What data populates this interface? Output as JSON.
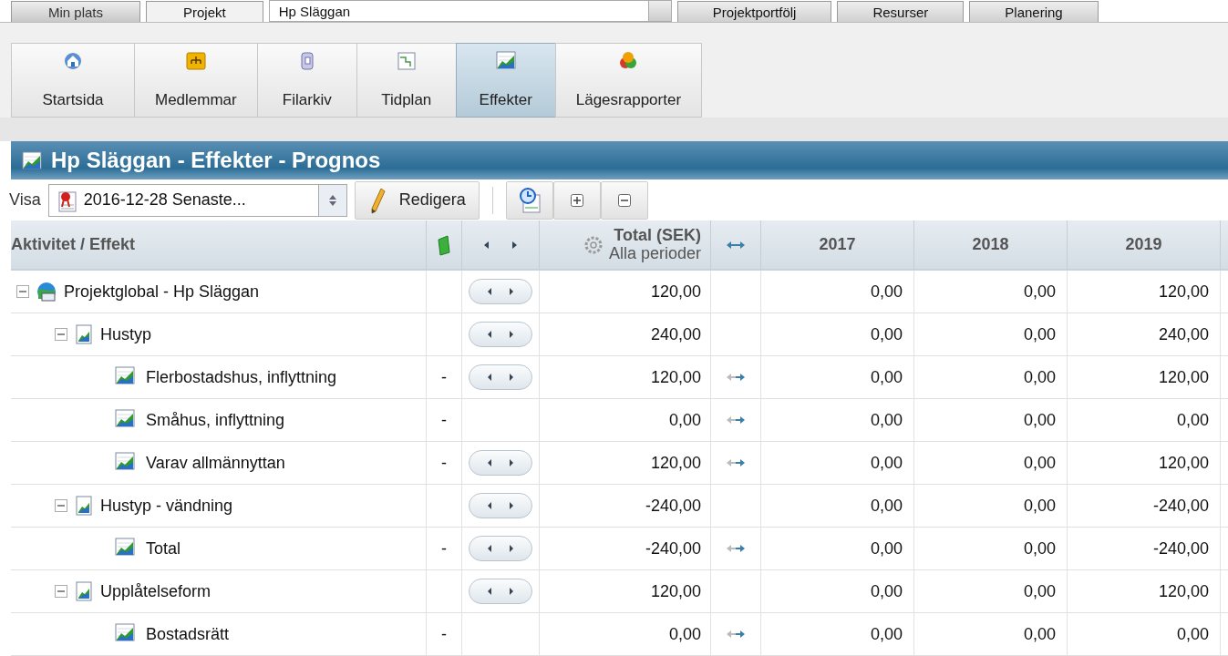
{
  "top_nav": {
    "tabs": [
      {
        "label": "Min plats",
        "selected": false
      },
      {
        "label": "Projekt",
        "selected": true
      }
    ],
    "project_select": "Hp Släggan",
    "right_tabs": [
      "Projektportfölj",
      "Resurser",
      "Planering"
    ]
  },
  "modules": [
    {
      "label": "Startsida",
      "selected": false
    },
    {
      "label": "Medlemmar",
      "selected": false
    },
    {
      "label": "Filarkiv",
      "selected": false
    },
    {
      "label": "Tidplan",
      "selected": false
    },
    {
      "label": "Effekter",
      "selected": true
    },
    {
      "label": "Lägesrapporter",
      "selected": false
    }
  ],
  "title": "Hp Släggan - Effekter - Prognos",
  "toolbar": {
    "label": "Visa",
    "version": "2016-12-28 Senaste...",
    "edit_button": "Redigera"
  },
  "table": {
    "columns": {
      "name": "Aktivitet / Effekt",
      "total": "Total (SEK)",
      "total_sub": "Alla perioder",
      "years": [
        "2017",
        "2018",
        "2019"
      ]
    },
    "rows": [
      {
        "name": "Projektglobal - Hp Släggan",
        "kind": "root",
        "expanded": true,
        "nav": true,
        "total": "120,00",
        "arrows": false,
        "values": [
          "0,00",
          "0,00",
          "120,00"
        ],
        "children": [
          {
            "name": "Hustyp",
            "kind": "group",
            "expanded": true,
            "nav": true,
            "total": "240,00",
            "arrows": false,
            "values": [
              "0,00",
              "0,00",
              "240,00"
            ],
            "children": [
              {
                "name": "Flerbostadshus, inflyttning",
                "kind": "leaf",
                "mark": "-",
                "nav": true,
                "total": "120,00",
                "arrows": true,
                "values": [
                  "0,00",
                  "0,00",
                  "120,00"
                ]
              },
              {
                "name": "Småhus, inflyttning",
                "kind": "leaf",
                "mark": "-",
                "nav": false,
                "total": "0,00",
                "arrows": true,
                "values": [
                  "0,00",
                  "0,00",
                  "0,00"
                ]
              },
              {
                "name": "Varav allmännyttan",
                "kind": "leaf",
                "mark": "-",
                "nav": true,
                "total": "120,00",
                "arrows": true,
                "values": [
                  "0,00",
                  "0,00",
                  "120,00"
                ]
              }
            ]
          },
          {
            "name": "Hustyp - vändning",
            "kind": "group",
            "expanded": true,
            "nav": true,
            "total": "-240,00",
            "arrows": false,
            "values": [
              "0,00",
              "0,00",
              "-240,00"
            ],
            "children": [
              {
                "name": "Total",
                "kind": "leaf",
                "mark": "-",
                "nav": true,
                "total": "-240,00",
                "arrows": true,
                "values": [
                  "0,00",
                  "0,00",
                  "-240,00"
                ]
              }
            ]
          },
          {
            "name": "Upplåtelseform",
            "kind": "group",
            "expanded": true,
            "nav": true,
            "total": "120,00",
            "arrows": false,
            "values": [
              "0,00",
              "0,00",
              "120,00"
            ],
            "children": [
              {
                "name": "Bostadsrätt",
                "kind": "leaf",
                "mark": "-",
                "nav": false,
                "total": "0,00",
                "arrows": true,
                "values": [
                  "0,00",
                  "0,00",
                  "0,00"
                ]
              }
            ]
          }
        ]
      }
    ]
  }
}
